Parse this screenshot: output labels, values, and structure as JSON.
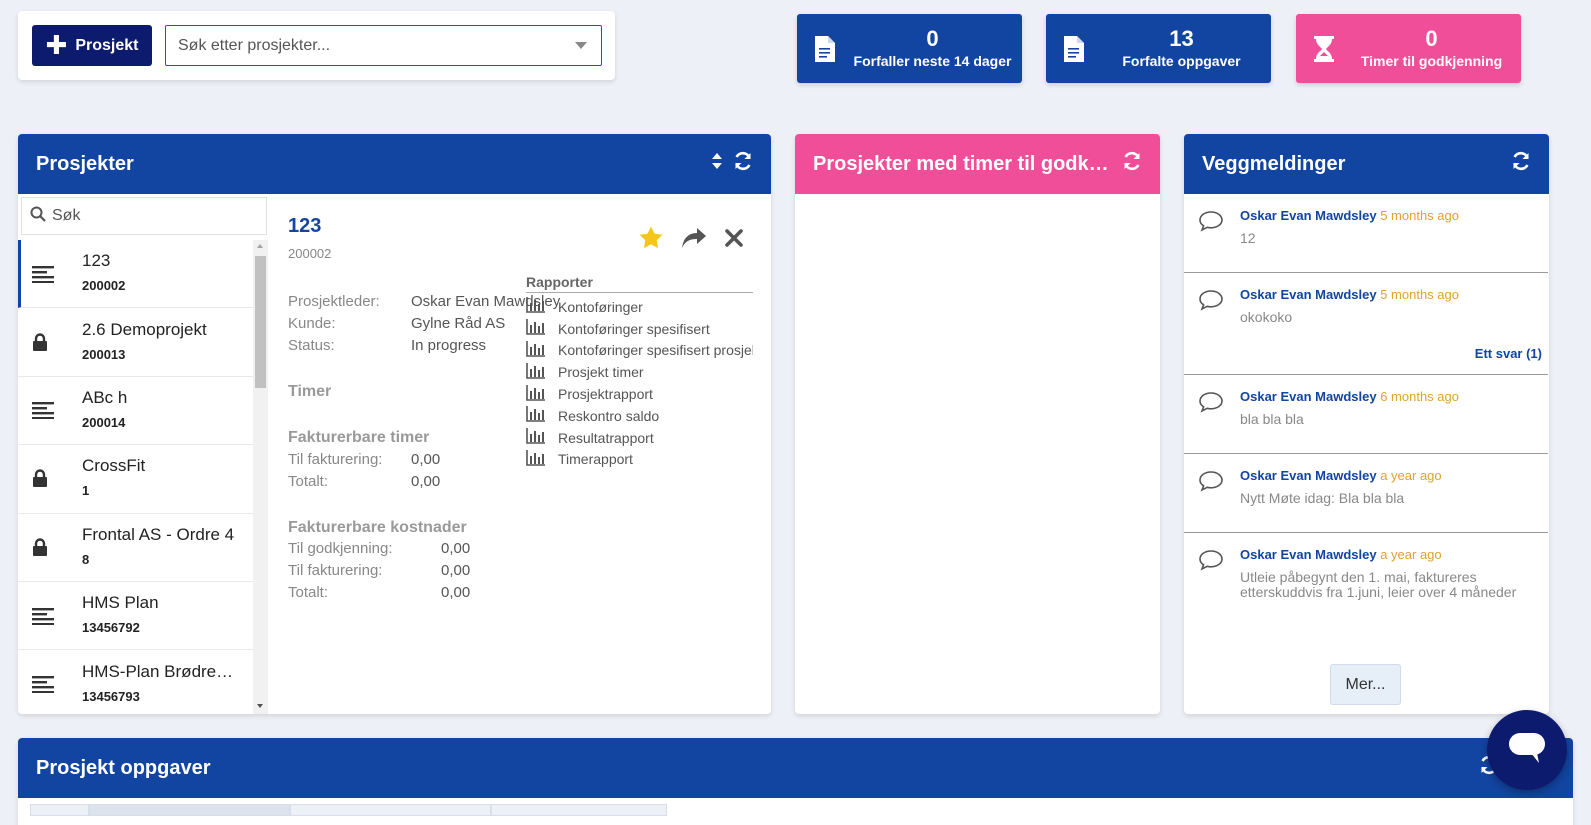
{
  "topbar": {
    "new_button_label": "Prosjekt",
    "search_placeholder": "Søk etter prosjekter..."
  },
  "stats": [
    {
      "value": "0",
      "label": "Forfaller neste 14 dager",
      "icon": "document-icon",
      "color": "#1245a1"
    },
    {
      "value": "13",
      "label": "Forfalte oppgaver",
      "icon": "document-icon",
      "color": "#1245a1"
    },
    {
      "value": "0",
      "label": "Timer til godkjenning",
      "icon": "hourglass-icon",
      "color": "#f04e98"
    }
  ],
  "projects_panel": {
    "title": "Prosjekter",
    "search_placeholder": "Søk",
    "items": [
      {
        "name": "123",
        "number": "200002",
        "icon": "list-icon"
      },
      {
        "name": "2.6 Demoprojekt",
        "number": "200013",
        "icon": "lock-icon"
      },
      {
        "name": "ABc h",
        "number": "200014",
        "icon": "list-icon"
      },
      {
        "name": "CrossFit",
        "number": "1",
        "icon": "lock-icon"
      },
      {
        "name": "Frontal AS - Ordre 4",
        "number": "8",
        "icon": "lock-icon"
      },
      {
        "name": "HMS Plan",
        "number": "13456792",
        "icon": "list-icon"
      },
      {
        "name": "HMS-Plan Brødrene AS",
        "number": "13456793",
        "icon": "list-icon"
      }
    ],
    "detail": {
      "title": "123",
      "number": "200002",
      "info": [
        {
          "key": "Prosjektleder:",
          "value": "Oskar Evan Mawdsley"
        },
        {
          "key": "Kunde:",
          "value": "Gylne Råd AS"
        },
        {
          "key": "Status:",
          "value": "In progress"
        }
      ],
      "timer_heading": "Timer",
      "billable_hours_heading": "Fakturerbare timer",
      "billable_hours": [
        {
          "key": "Til fakturering:",
          "value": "0,00"
        },
        {
          "key": "Totalt:",
          "value": "0,00"
        }
      ],
      "billable_costs_heading": "Fakturerbare kostnader",
      "billable_costs": [
        {
          "key": "Til godkjenning:",
          "value": "0,00"
        },
        {
          "key": "Til fakturering:",
          "value": "0,00"
        },
        {
          "key": "Totalt:",
          "value": "0,00"
        }
      ],
      "reports_heading": "Rapporter",
      "reports": [
        "Kontoføringer",
        "Kontoføringer spesifisert",
        "Kontoføringer spesifisert prosjekt",
        "Prosjekt timer",
        "Prosjektrapport",
        "Reskontro saldo",
        "Resultatrapport",
        "Timerapport"
      ]
    }
  },
  "approval_panel": {
    "title": "Prosjekter med timer til godkjenning"
  },
  "wall_panel": {
    "title": "Veggmeldinger",
    "messages": [
      {
        "author": "Oskar Evan Mawdsley",
        "ago": "5 months ago",
        "body": "12",
        "reply": ""
      },
      {
        "author": "Oskar Evan Mawdsley",
        "ago": "5 months ago",
        "body": "okokoko",
        "reply": "Ett svar (1)"
      },
      {
        "author": "Oskar Evan Mawdsley",
        "ago": "6 months ago",
        "body": "bla bla bla",
        "reply": ""
      },
      {
        "author": "Oskar Evan Mawdsley",
        "ago": "a year ago",
        "body": "Nytt Møte idag: Bla bla bla",
        "reply": ""
      },
      {
        "author": "Oskar Evan Mawdsley",
        "ago": "a year ago",
        "body": "Utleie påbegynt den 1. mai, faktureres etterskuddvis fra 1.juni, leier over 4 måneder",
        "reply": ""
      }
    ],
    "more_label": "Mer..."
  },
  "tasks_panel": {
    "title": "Prosjekt oppgaver"
  },
  "colors": {
    "primary": "#1245a1",
    "dark_navy": "#0d1b6e",
    "pink": "#f04e98",
    "star": "#f5c518",
    "time_ago": "#e0a22f"
  }
}
